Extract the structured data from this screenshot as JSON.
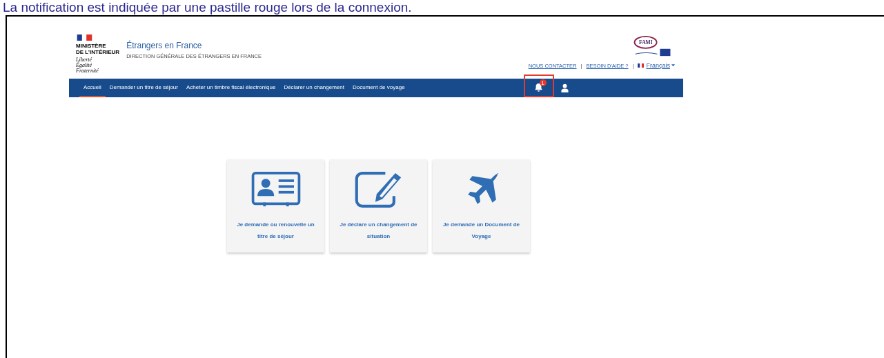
{
  "caption": "La notification est indiquée par une pastille rouge lors de la connexion.",
  "header": {
    "ministry": [
      "MINISTÈRE",
      "DE L’INTÉRIEUR"
    ],
    "motto": [
      "Liberté",
      "Égalité",
      "Fraternité"
    ],
    "site_title": "Étrangers en France",
    "site_subtitle": "DIRECTION GÉNÉRALE DES ÉTRANGERS EN FRANCE",
    "partner_logo": "FAMI"
  },
  "top_links": [
    {
      "kind": "link",
      "label": "NOUS CONTACTER"
    },
    {
      "kind": "separator",
      "label": "|"
    },
    {
      "kind": "link",
      "label": "BESOIN D'AIDE ?"
    },
    {
      "kind": "separator",
      "label": "|"
    },
    {
      "kind": "language",
      "label": "Français"
    }
  ],
  "nav": [
    {
      "label": "Accueil",
      "selected": true
    },
    {
      "label": "Demander un titre de séjour",
      "selected": false
    },
    {
      "label": "Acheter un timbre fiscal électronique",
      "selected": false
    },
    {
      "label": "Déclarer un changement",
      "selected": false
    },
    {
      "label": "Document de voyage",
      "selected": false
    }
  ],
  "notifications": {
    "count": "1",
    "highlighted": true
  },
  "cards": [
    {
      "kind": "id-card",
      "label": "Je demande ou renouvelle un titre de séjour"
    },
    {
      "kind": "edit",
      "label": "Je déclare un changement de situation"
    },
    {
      "kind": "plane",
      "label": "Je demande un Document de Voyage"
    }
  ]
}
